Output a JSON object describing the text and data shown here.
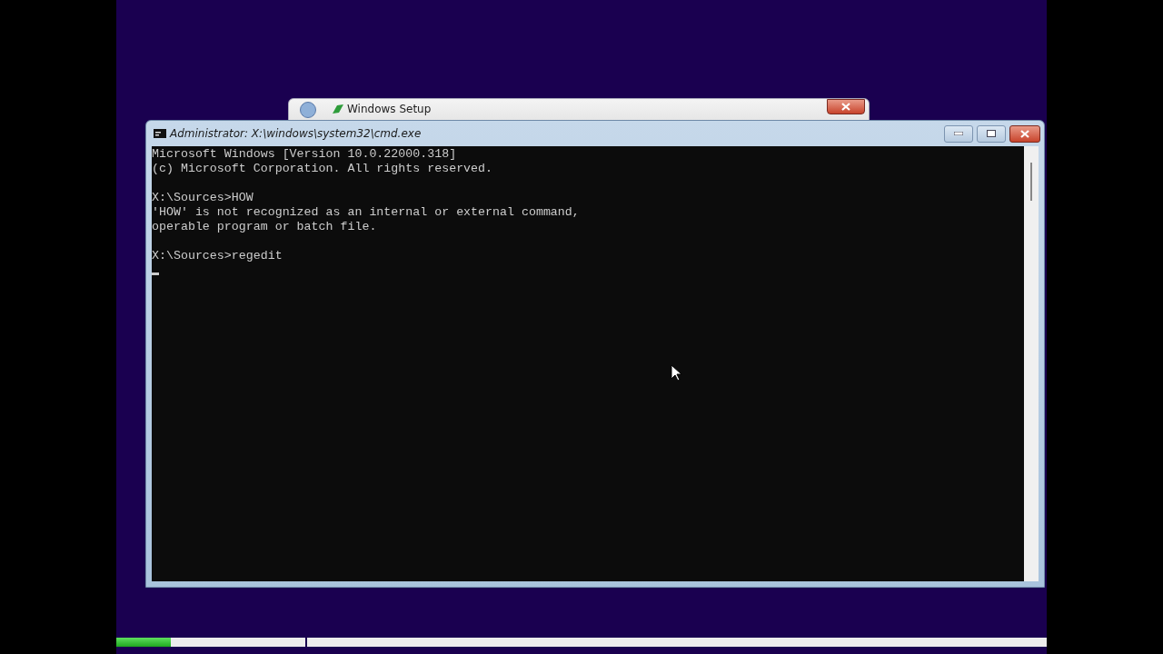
{
  "background_window": {
    "title": "Windows Setup"
  },
  "console_window": {
    "title": "Administrator: X:\\windows\\system32\\cmd.exe",
    "blocks": [
      [
        "Microsoft Windows [Version 10.0.22000.318]",
        "(c) Microsoft Corporation. All rights reserved."
      ],
      [
        "X:\\Sources>HOW",
        "'HOW' is not recognized as an internal or external command,",
        "operable program or batch file."
      ],
      [
        "X:\\Sources>regedit"
      ]
    ]
  },
  "setup_progress": {
    "level": 0.29
  }
}
